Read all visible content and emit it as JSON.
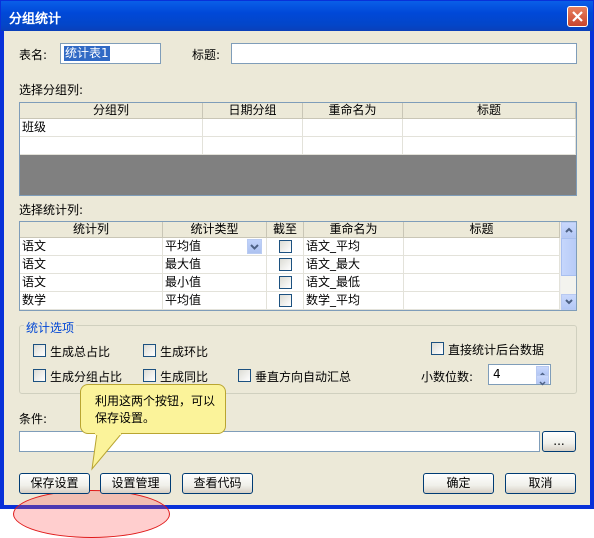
{
  "window": {
    "title": "分组统计"
  },
  "form": {
    "table_name_label": "表名:",
    "table_name_value": "统计表1",
    "title_label": "标题:",
    "title_value": ""
  },
  "group_section": {
    "label": "选择分组列:",
    "columns": [
      "分组列",
      "日期分组",
      "重命名为",
      "标题"
    ],
    "rows": [
      [
        "班级",
        "",
        "",
        ""
      ]
    ]
  },
  "stats_section": {
    "label": "选择统计列:",
    "columns": [
      "统计列",
      "统计类型",
      "截至",
      "重命名为",
      "标题"
    ],
    "rows": [
      {
        "column": "语文",
        "type": "平均值",
        "checked": false,
        "rename": "语文_平均",
        "title": ""
      },
      {
        "column": "语文",
        "type": "最大值",
        "checked": false,
        "rename": "语文_最大",
        "title": ""
      },
      {
        "column": "语文",
        "type": "最小值",
        "checked": false,
        "rename": "语文_最低",
        "title": ""
      },
      {
        "column": "数学",
        "type": "平均值",
        "checked": false,
        "rename": "数学_平均",
        "title": ""
      }
    ]
  },
  "options": {
    "legend": "统计选项",
    "total_ratio": "生成总占比",
    "ring_ratio": "生成环比",
    "group_ratio": "生成分组占比",
    "yoy_ratio": "生成同比",
    "vertical_summary": "垂直方向自动汇总",
    "direct_backend": "直接统计后台数据",
    "decimals_label": "小数位数:",
    "decimals_value": "4"
  },
  "condition": {
    "label": "条件:",
    "value": "",
    "browse_label": "..."
  },
  "tooltip": {
    "text": "利用这两个按钮，可以保存设置。"
  },
  "buttons": {
    "save_settings": "保存设置",
    "manage_settings": "设置管理",
    "view_code": "查看代码",
    "ok": "确定",
    "cancel": "取消"
  },
  "colors": {
    "accent": "#0831d9",
    "highlight_red": "#e01a1a",
    "tooltip_yellow": "#fbf39a",
    "group_legend_blue": "#0046d5"
  }
}
